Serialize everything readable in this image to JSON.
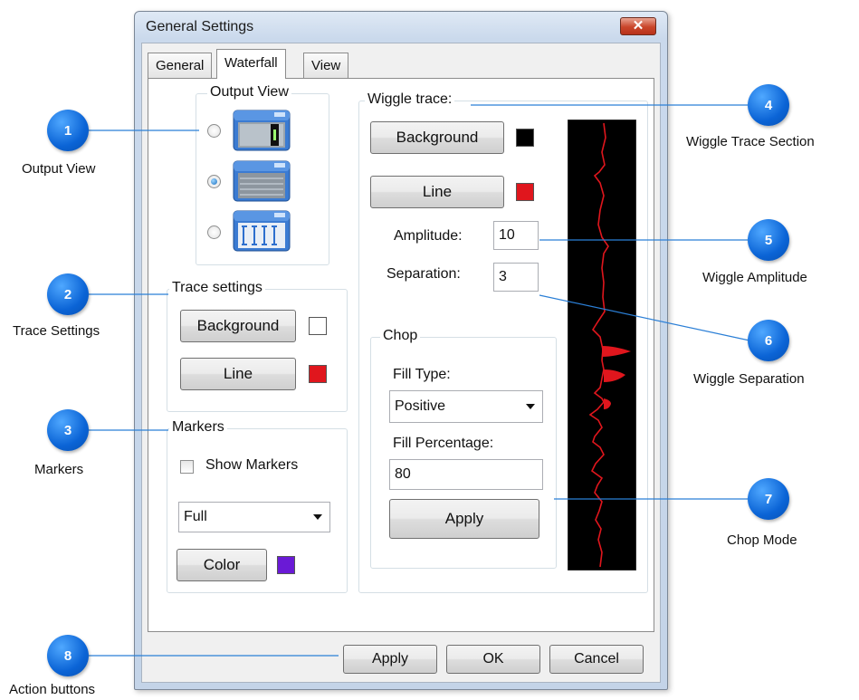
{
  "window": {
    "title": "General Settings",
    "close_glyph": "✕"
  },
  "tabs": [
    {
      "label": "General",
      "active": false
    },
    {
      "label": "Waterfall",
      "active": true
    },
    {
      "label": "View",
      "active": false
    }
  ],
  "output_view": {
    "legend": "Output View",
    "options": [
      {
        "icon": "trace-view-icon",
        "selected": false
      },
      {
        "icon": "waterfall-view-icon",
        "selected": true
      },
      {
        "icon": "wiggle-view-icon",
        "selected": false
      }
    ]
  },
  "trace_settings": {
    "legend": "Trace settings",
    "background_label": "Background",
    "background_color": "#ffffff",
    "line_label": "Line",
    "line_color": "#e0161d"
  },
  "markers": {
    "legend": "Markers",
    "show_label": "Show Markers",
    "show_checked": false,
    "style_value": "Full",
    "color_label": "Color",
    "color": "#6a1ad6"
  },
  "wiggle_trace": {
    "legend": "Wiggle trace:",
    "background_label": "Background",
    "background_color": "#000000",
    "line_label": "Line",
    "line_color": "#e0161d",
    "amplitude_label": "Amplitude:",
    "amplitude_value": "10",
    "separation_label": "Separation:",
    "separation_value": "3"
  },
  "chop": {
    "legend": "Chop",
    "fill_type_label": "Fill Type:",
    "fill_type_value": "Positive",
    "fill_percentage_label": "Fill Percentage:",
    "fill_percentage_value": "80",
    "apply_label": "Apply"
  },
  "preview": {
    "background": "#000000",
    "trace_color": "#e0161d"
  },
  "footer": {
    "apply_label": "Apply",
    "ok_label": "OK",
    "cancel_label": "Cancel"
  },
  "callouts": [
    {
      "number": "1",
      "caption": "Output View"
    },
    {
      "number": "2",
      "caption": "Trace Settings"
    },
    {
      "number": "3",
      "caption": "Markers"
    },
    {
      "number": "4",
      "caption": "Wiggle Trace Section"
    },
    {
      "number": "5",
      "caption": "Wiggle Amplitude"
    },
    {
      "number": "6",
      "caption": "Wiggle Separation"
    },
    {
      "number": "7",
      "caption": "Chop Mode"
    },
    {
      "number": "8",
      "caption": "Action buttons"
    }
  ],
  "accent_color": "#0b64d6"
}
